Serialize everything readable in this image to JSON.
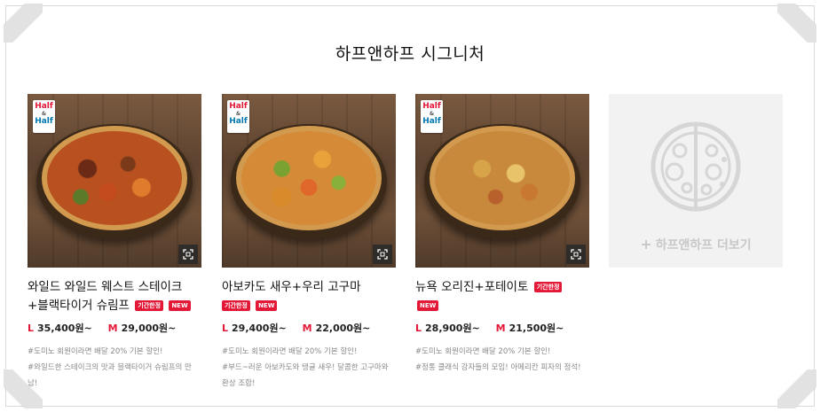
{
  "section": {
    "title": "하프앤하프 시그니처"
  },
  "products": [
    {
      "name": "와일드 와일드 웨스트 스테이크+블랙타이거 슈림프",
      "badges": [
        "기간한정",
        "NEW"
      ],
      "price_l_label": "L",
      "price_l": "35,400원~",
      "price_m_label": "M",
      "price_m": "29,000원~",
      "desc1": "#도미노 회원이라면 배달 20% 기본 할인!",
      "desc2": "#와일드한 스테이크의 맛과 블랙타이거 슈림프의 만남!"
    },
    {
      "name": "아보카도 새우+우리 고구마",
      "badges": [
        "기간한정",
        "NEW"
      ],
      "price_l_label": "L",
      "price_l": "29,400원~",
      "price_m_label": "M",
      "price_m": "22,000원~",
      "desc1": "#도미노 회원이라면 배달 20% 기본 할인!",
      "desc2": "#부드~러운 아보카도와 탱글 새우! 달콤한 고구마와 환상 조합!"
    },
    {
      "name": "뉴욕 오리진+포테이토",
      "badges": [
        "기간한정",
        "NEW"
      ],
      "price_l_label": "L",
      "price_l": "28,900원~",
      "price_m_label": "M",
      "price_m": "21,500원~",
      "desc1": "#도미노 회원이라면 배달 20% 기본 할인!",
      "desc2": "#정통 클래식 강자들의 모임! 아메리칸 피자의 정석!"
    }
  ],
  "halfhalf_logo": {
    "line1": "Half",
    "amp": "&",
    "line2": "Half"
  },
  "more": {
    "plus": "+",
    "label": "하프앤하프 더보기",
    "icon": "half-half-pizza-icon"
  },
  "colors": {
    "accent": "#e31837",
    "secondary": "#0078ae",
    "muted": "#888888"
  }
}
